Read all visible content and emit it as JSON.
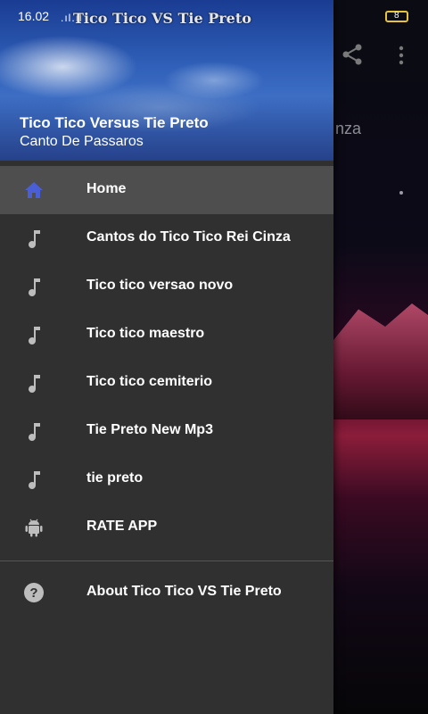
{
  "status_bar": {
    "time": "16.02",
    "signal": ".ıl.ıl",
    "app_title": "Tico Tico VS Tie Preto",
    "battery": "8"
  },
  "background": {
    "partial_text": "nza"
  },
  "drawer": {
    "title": "Tico Tico Versus Tie Preto",
    "subtitle": "Canto De Passaros",
    "items": [
      {
        "label": "Home",
        "icon": "home-icon",
        "active": true
      },
      {
        "label": "Cantos do Tico Tico Rei Cinza",
        "icon": "music-note-icon"
      },
      {
        "label": "Tico tico versao novo",
        "icon": "music-note-icon"
      },
      {
        "label": "Tico tico maestro",
        "icon": "music-note-icon"
      },
      {
        "label": "Tico tico cemiterio",
        "icon": "music-note-icon"
      },
      {
        "label": "Tie Preto New Mp3",
        "icon": "music-note-icon"
      },
      {
        "label": "tie preto",
        "icon": "music-note-icon"
      },
      {
        "label": "RATE APP",
        "icon": "android-icon"
      }
    ],
    "footer_item": {
      "label": "About Tico Tico VS Tie Preto",
      "icon": "help-icon"
    }
  },
  "colors": {
    "drawer_bg": "#303030",
    "active_item_bg": "#4e4e4e",
    "home_icon": "#4a5fd6",
    "icon_gray": "#bdbdbd"
  }
}
